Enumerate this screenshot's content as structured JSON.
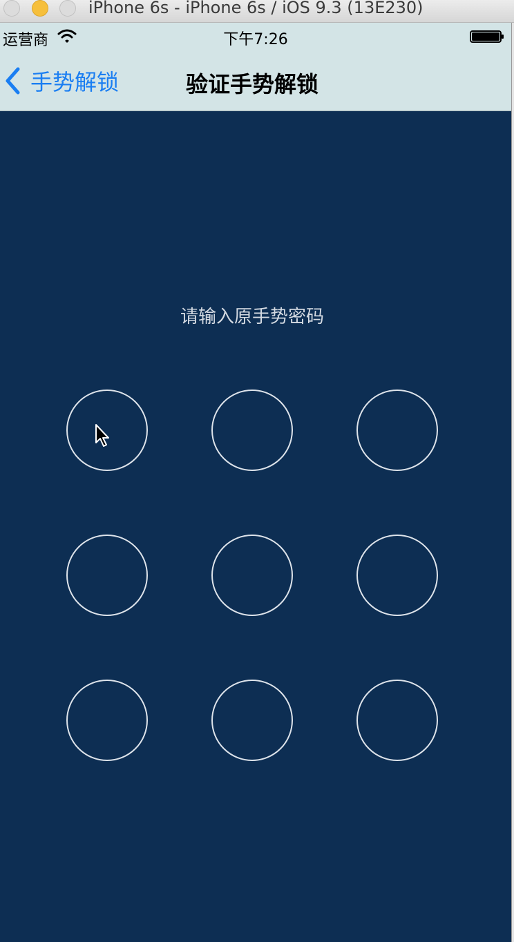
{
  "window": {
    "title": "iPhone 6s - iPhone 6s / iOS 9.3 (13E230)"
  },
  "status_bar": {
    "carrier": "运营商",
    "time": "下午7:26",
    "wifi_icon": "wifi-icon",
    "battery_icon": "battery-full-icon"
  },
  "nav_bar": {
    "back_label": "手势解锁",
    "back_icon": "chevron-left-icon",
    "title": "验证手势解锁"
  },
  "main": {
    "prompt": "请输入原手势密码",
    "grid": {
      "rows": 3,
      "columns": 3,
      "selected": []
    }
  },
  "colors": {
    "background": "#0d2e53",
    "nav_bar": "#d3e4e6",
    "accent": "#1a7ef2",
    "node_stroke": "#dde3ea",
    "prompt_text": "#d4dae2"
  }
}
